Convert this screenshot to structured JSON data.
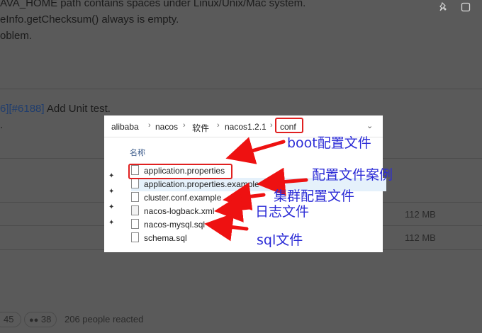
{
  "background": {
    "lines": [
      "AVA_HOME path contains spaces under Linux/Unix/Mac system.",
      "eInfo.getChecksum() always is empty.",
      "oblem."
    ],
    "commit_prefix": "6]",
    "commit_link": "[#6188]",
    "commit_text": " Add Unit test.",
    "commit_tail": ".",
    "asset_sizes": [
      "112 MB",
      "112 MB"
    ],
    "reactions": {
      "count_a": "45",
      "count_b": "38",
      "reacted_text": "206 people reacted"
    }
  },
  "explorer": {
    "breadcrumb": [
      "alibaba",
      "nacos",
      "软件",
      "nacos1.2.1",
      "conf"
    ],
    "column_header": "名称",
    "files": [
      {
        "name": "application.properties",
        "icon": "file-icon"
      },
      {
        "name": "application.properties.example",
        "icon": "file-icon"
      },
      {
        "name": "cluster.conf.example",
        "icon": "file-icon"
      },
      {
        "name": "nacos-logback.xml",
        "icon": "xml-file-icon"
      },
      {
        "name": "nacos-mysql.sql",
        "icon": "file-icon"
      },
      {
        "name": "schema.sql",
        "icon": "file-icon"
      }
    ]
  },
  "annotations": {
    "boot": "boot配置文件",
    "example": "配置文件案例",
    "cluster": "集群配置文件",
    "log": "日志文件",
    "sql": "sql文件"
  },
  "colors": {
    "highlight_box": "#e02020",
    "annotation_text": "#2b2bd6",
    "arrow": "#ee1111"
  }
}
